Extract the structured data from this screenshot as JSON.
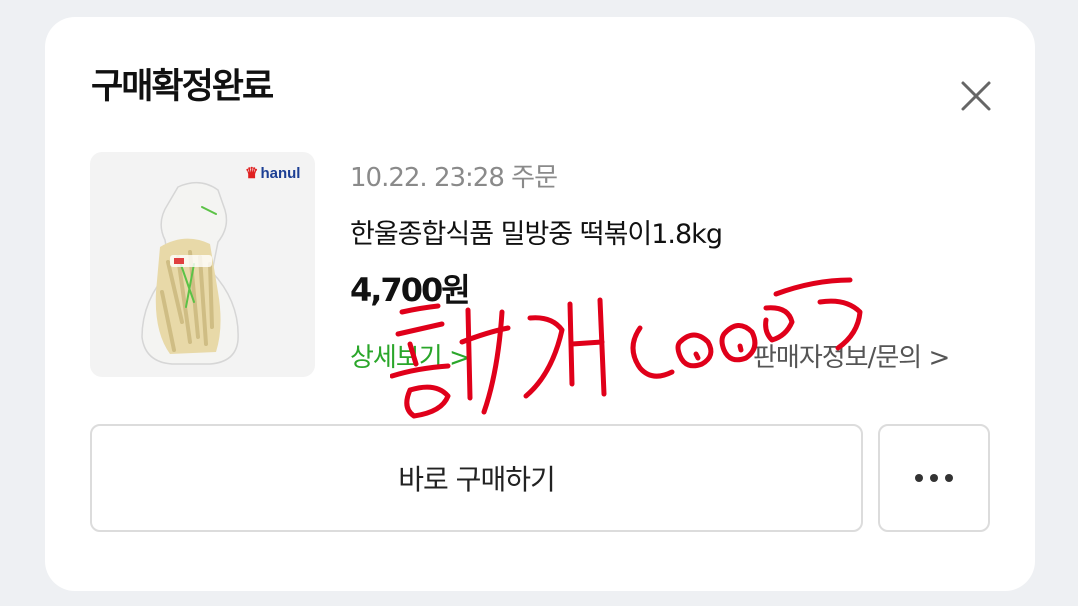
{
  "dialog": {
    "title": "구매확정완료"
  },
  "product": {
    "brand": "hanul",
    "order_date": "10.22. 23:28 주문",
    "name": "한울종합식품 밀방중 떡볶이1.8kg",
    "price": "4,700원"
  },
  "links": {
    "detail": "상세보기 >",
    "seller": "판매자정보/문의 >"
  },
  "actions": {
    "buy_again": "바로 구매하기"
  },
  "icons": {
    "close": "close-icon",
    "more": "more-dots-icon"
  },
  "colors": {
    "detail_link": "#2aa62a",
    "annotation": "#e0001a"
  }
}
